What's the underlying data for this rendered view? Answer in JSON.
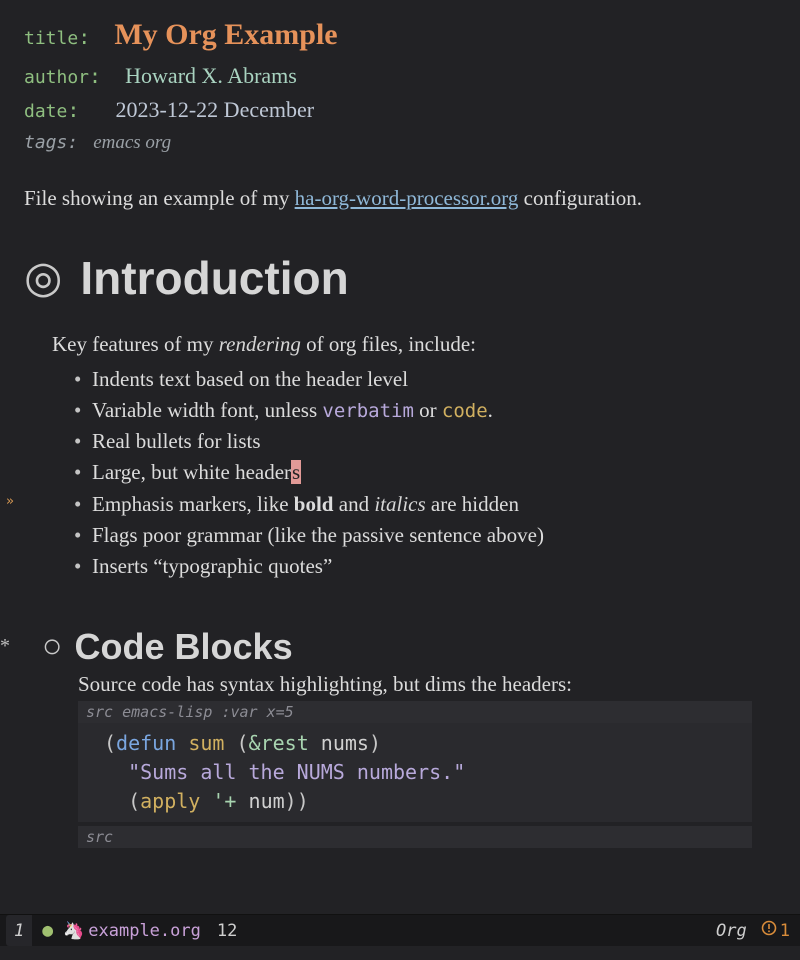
{
  "meta": {
    "title_key": "title",
    "title_val": "My Org Example",
    "author_key": "author",
    "author_val": "Howard X. Abrams",
    "date_key": "date",
    "date_val": "2023-12-22 December",
    "tags_key": "tags:",
    "tags_val": "emacs org"
  },
  "intro": {
    "pre": "File showing an example of my ",
    "link": "ha-org-word-processor.org",
    "post": " configuration."
  },
  "h1": {
    "text": "Introduction",
    "lead_pre": "Key features of my ",
    "lead_em": "rendering",
    "lead_post": " of org files, include:"
  },
  "bullets": {
    "b1": "Indents text based on the header level",
    "b2_pre": "Variable width font, unless ",
    "b2_verb": "verbatim",
    "b2_mid": " or ",
    "b2_code": "code",
    "b2_post": ".",
    "b3": "Real bullets for lists",
    "b4_pre": "Large, but white header",
    "b4_cursor": "s",
    "b5_pre": "Emphasis markers, like ",
    "b5_bold": "bold",
    "b5_mid": " and ",
    "b5_ital": "italics",
    "b5_post": " are hidden",
    "b6": "Flags poor grammar (like the passive sentence above)",
    "b7": "Inserts “typographic quotes”"
  },
  "h2": {
    "text": "Code Blocks",
    "lead": "Source code has syntax highlighting, but dims the headers:"
  },
  "src": {
    "header_label": "src",
    "header_lang": "emacs-lisp :var x=5",
    "l1_a": "(",
    "l1_kw": "defun",
    "l1_sp1": " ",
    "l1_fn": "sum",
    "l1_sp2": " (",
    "l1_amp": "&rest",
    "l1_sp3": " ",
    "l1_arg": "nums",
    "l1_b": ")",
    "l2_doc": "  \"Sums all the NUMS numbers.\"",
    "l3_a": "  (",
    "l3_fn": "apply",
    "l3_sp": " ",
    "l3_sym": "'+",
    "l3_sp2": " ",
    "l3_arg": "num",
    "l3_b": "))",
    "footer_label": "src"
  },
  "gutter": {
    "mark": "»"
  },
  "modeline": {
    "left_num": "1",
    "dot": "●",
    "unicorn": "🦄",
    "filename": "example.org",
    "col": "12",
    "mode": "Org",
    "warn_icon": "⚠",
    "warn_count": "1"
  }
}
